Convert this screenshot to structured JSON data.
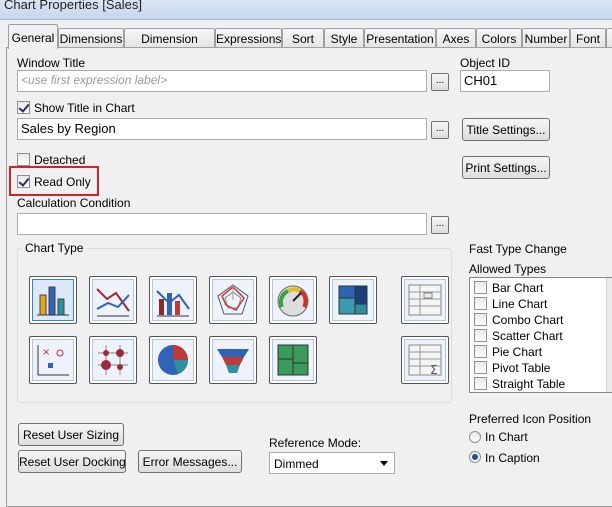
{
  "window": {
    "title": "Chart Properties [Sales]"
  },
  "tabs": [
    "General",
    "Dimensions",
    "Dimension Limits",
    "Expressions",
    "Sort",
    "Style",
    "Presentation",
    "Axes",
    "Colors",
    "Number",
    "Font"
  ],
  "general": {
    "window_title_label": "Window Title",
    "window_title_placeholder": "<use first expression label>",
    "object_id_label": "Object ID",
    "object_id_value": "CH01",
    "show_title_label": "Show Title in Chart",
    "show_title_checked": true,
    "chart_title_value": "Sales by Region",
    "title_settings_button": "Title Settings...",
    "print_settings_button": "Print Settings...",
    "detached_label": "Detached",
    "detached_checked": false,
    "read_only_label": "Read Only",
    "read_only_checked": true,
    "calc_condition_label": "Calculation Condition",
    "calc_condition_value": "",
    "dots": "..."
  },
  "chart_type": {
    "group_label": "Chart Type",
    "icons": [
      "bar-chart-icon",
      "line-chart-icon",
      "combo-chart-icon",
      "radar-chart-icon",
      "gauge-chart-icon",
      "block-chart-icon",
      "pivot-table-icon",
      "scatter-chart-icon",
      "grid-chart-icon",
      "pie-chart-icon",
      "funnel-chart-icon",
      "mekko-chart-icon",
      "straight-table-icon"
    ],
    "selected": "bar-chart-icon"
  },
  "fast_type": {
    "group_label": "Fast Type Change",
    "allowed_label": "Allowed Types",
    "items": [
      "Bar Chart",
      "Line Chart",
      "Combo Chart",
      "Scatter Chart",
      "Pie Chart",
      "Pivot Table",
      "Straight Table"
    ]
  },
  "icon_position": {
    "label": "Preferred Icon Position",
    "options": [
      "In Chart",
      "In Caption"
    ],
    "selected": "In Caption"
  },
  "buttons": {
    "reset_sizing": "Reset User Sizing",
    "reset_docking": "Reset User Docking",
    "error_messages": "Error Messages..."
  },
  "reference_mode": {
    "label": "Reference Mode:",
    "value": "Dimmed"
  },
  "colors": {
    "highlight": "#d6202a",
    "selected_border": "#3c7fd6"
  }
}
